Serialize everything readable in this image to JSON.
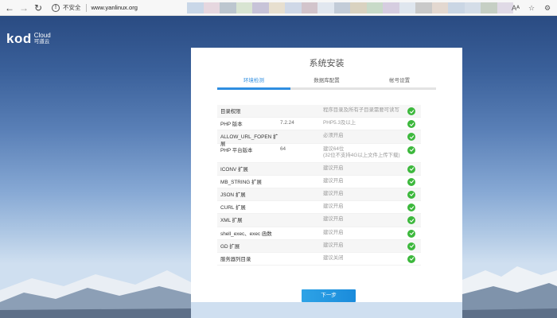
{
  "browser": {
    "insecure_label": "不安全",
    "url": "www.yanlinux.org",
    "blur_colors": [
      "#c9d7e8",
      "#e6d7df",
      "#bcc6cf",
      "#d8e4d2",
      "#c7c3d8",
      "#e7dfcf",
      "#cfd8e7",
      "#d2c4cb",
      "#e1e7ef",
      "#c3ccd8",
      "#d9d2c0",
      "#c8dac8",
      "#d6cde0",
      "#dfe6ee",
      "#c9c9c9",
      "#e3d8d0",
      "#cad6e4",
      "#d4dde8",
      "#c6cfc4",
      "#e0dae6"
    ]
  },
  "logo": {
    "mark": "kod",
    "en": "Cloud",
    "cn": "可道云"
  },
  "install": {
    "title": "系统安装",
    "steps": [
      {
        "label": "环境检测",
        "active": true
      },
      {
        "label": "数据库配置",
        "active": false
      },
      {
        "label": "帐号设置",
        "active": false
      }
    ],
    "checks": [
      {
        "name": "目录权限",
        "value": "",
        "note": "程序目录及所有子目录需要可读写",
        "ok": true
      },
      {
        "name": "PHP 版本",
        "value": "7.2.24",
        "note": "PHP5.3及以上",
        "ok": true
      },
      {
        "name": "ALLOW_URL_FOPEN 扩展",
        "value": "",
        "note": "必须开启",
        "ok": true
      },
      {
        "name": "PHP 平台版本",
        "value": "64",
        "note": "建议64位",
        "note2": "(32位不支持4G以上文件上传下载)",
        "ok": true
      },
      {
        "name": "ICONV 扩展",
        "value": "",
        "note": "建议开启",
        "ok": true
      },
      {
        "name": "MB_STRING 扩展",
        "value": "",
        "note": "建议开启",
        "ok": true
      },
      {
        "name": "JSON 扩展",
        "value": "",
        "note": "建议开启",
        "ok": true
      },
      {
        "name": "CURL 扩展",
        "value": "",
        "note": "建议开启",
        "ok": true
      },
      {
        "name": "XML 扩展",
        "value": "",
        "note": "建议开启",
        "ok": true
      },
      {
        "name": "shell_exec、exec 函数",
        "value": "",
        "note": "建议开启",
        "ok": true
      },
      {
        "name": "GD 扩展",
        "value": "",
        "note": "建议开启",
        "ok": true
      },
      {
        "name": "服务器列目录",
        "value": "",
        "note": "建议关闭",
        "ok": true
      }
    ],
    "next_label": "下一步"
  }
}
